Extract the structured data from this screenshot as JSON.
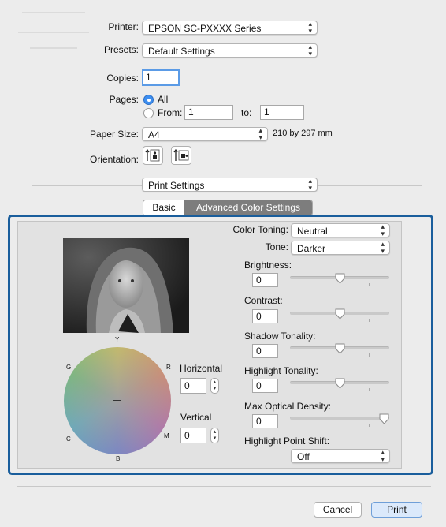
{
  "printer": {
    "label": "Printer:",
    "value": "EPSON SC-PXXXX Series"
  },
  "presets": {
    "label": "Presets:",
    "value": "Default Settings"
  },
  "copies": {
    "label": "Copies:",
    "value": "1"
  },
  "pages": {
    "label": "Pages:",
    "all": "All",
    "from_label": "From:",
    "from_value": "1",
    "to_label": "to:",
    "to_value": "1",
    "selected": "All"
  },
  "paper_size": {
    "label": "Paper Size:",
    "value": "A4",
    "dimensions": "210 by 297 mm"
  },
  "orientation": {
    "label": "Orientation:",
    "options": [
      "portrait-icon",
      "landscape-icon"
    ],
    "selected": "portrait"
  },
  "section_popup": {
    "value": "Print Settings"
  },
  "tabs": [
    {
      "label": "Basic",
      "selected": false
    },
    {
      "label": "Advanced Color Settings",
      "selected": true
    }
  ],
  "color": {
    "color_toning": {
      "label": "Color Toning:",
      "value": "Neutral"
    },
    "tone": {
      "label": "Tone:",
      "value": "Darker"
    },
    "brightness": {
      "label": "Brightness:",
      "value": "0",
      "level": 0.5
    },
    "contrast": {
      "label": "Contrast:",
      "value": "0",
      "level": 0.5
    },
    "shadow_tonality": {
      "label": "Shadow Tonality:",
      "value": "0",
      "level": 0.5
    },
    "highlight_tonality": {
      "label": "Highlight Tonality:",
      "value": "0",
      "level": 0.5
    },
    "max_optical_density": {
      "label": "Max Optical Density:",
      "value": "0",
      "level": 1.0
    },
    "highlight_point_shift": {
      "label": "Highlight Point Shift:",
      "value": "Off"
    }
  },
  "color_wheel": {
    "y": "Y",
    "r": "R",
    "m": "M",
    "b": "B",
    "c": "C",
    "g": "G"
  },
  "horizontal": {
    "label": "Horizontal",
    "value": "0"
  },
  "vertical": {
    "label": "Vertical",
    "value": "0"
  },
  "footer": {
    "cancel": "Cancel",
    "print": "Print"
  },
  "colors": {
    "accent": "#3d8ef0",
    "highlight_border": "#1a5e9c",
    "tab_selected": "#7d7d7d"
  }
}
